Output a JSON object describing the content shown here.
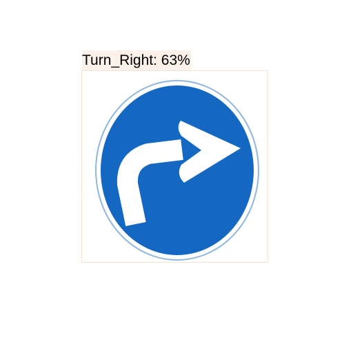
{
  "detection": {
    "label": "Turn_Right: 63%",
    "class": "Turn_Right",
    "confidence": 0.63
  },
  "sign": {
    "icon": "turn-right-arrow-icon",
    "fill_color": "#1568c2",
    "arrow_color": "#ffffff"
  },
  "colors": {
    "label_background": "#fbf1e9",
    "bbox_border": "#f6e6da"
  }
}
